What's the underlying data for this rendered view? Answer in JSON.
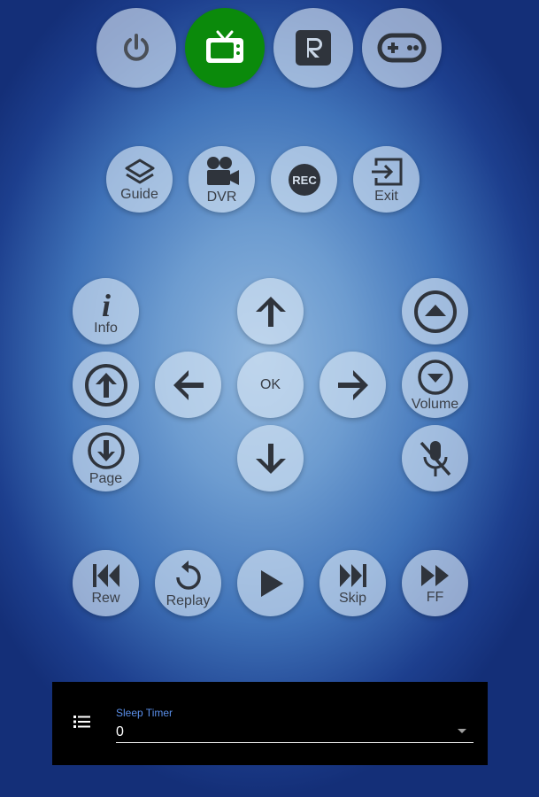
{
  "colors": {
    "active": "#0b8a0b",
    "icon": "#2b2f36",
    "accent": "#5a8ee8"
  },
  "top_row": [
    {
      "icon": "power-icon"
    },
    {
      "icon": "tv-icon",
      "active": true
    },
    {
      "icon": "roku-r-icon"
    },
    {
      "icon": "gamepad-icon"
    }
  ],
  "row2": {
    "guide": "Guide",
    "dvr": "DVR",
    "rec": "REC",
    "exit": "Exit"
  },
  "nav": {
    "info": "Info",
    "ok": "OK",
    "volume": "Volume",
    "page": "Page"
  },
  "transport": {
    "rew": "Rew",
    "replay": "Replay",
    "skip": "Skip",
    "ff": "FF"
  },
  "sleep_timer": {
    "label": "Sleep Timer",
    "value": "0"
  }
}
